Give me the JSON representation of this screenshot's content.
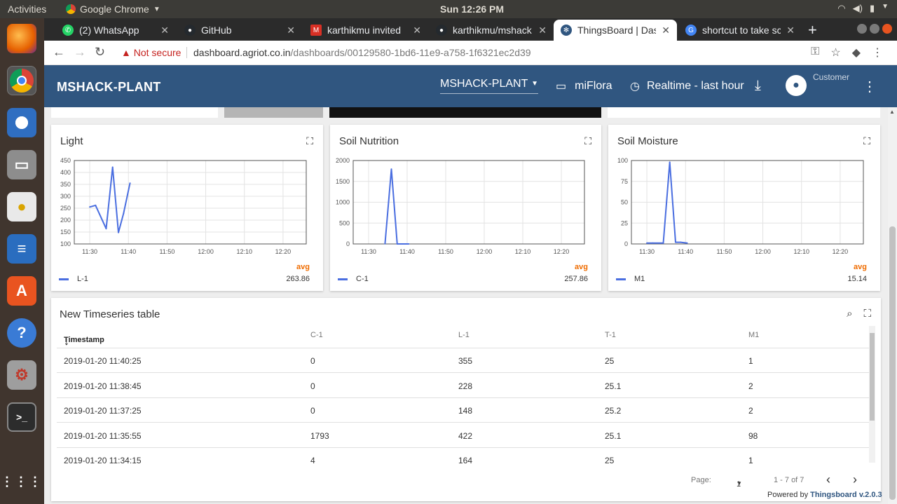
{
  "system": {
    "activities": "Activities",
    "app_name": "Google Chrome",
    "clock": "Sun 12:26 PM"
  },
  "tabs": [
    {
      "title": "(2) WhatsApp",
      "color": "#25d366"
    },
    {
      "title": "GitHub",
      "color": "#24292e"
    },
    {
      "title": "karthikmu invited",
      "color": "#d93025"
    },
    {
      "title": "karthikmu/mshack",
      "color": "#24292e"
    },
    {
      "title": "ThingsBoard | Das",
      "color": "#305680"
    },
    {
      "title": "shortcut to take sc",
      "color": "#4285f4"
    }
  ],
  "address_bar": {
    "security": "Not secure",
    "url_host": "dashboard.agriot.co.in",
    "url_path": "/dashboards/00129580-1bd6-11e9-a758-1f6321ec2d39"
  },
  "header": {
    "title": "MSHACK-PLANT",
    "dashboard_select": "MSHACK-PLANT",
    "entity": "miFlora",
    "timewindow": "Realtime - last hour",
    "user_role": "Customer"
  },
  "widgets": [
    {
      "title": "Light",
      "legend": "L-1",
      "avg_label": "avg",
      "avg": "263.86"
    },
    {
      "title": "Soil Nutrition",
      "legend": "C-1",
      "avg_label": "avg",
      "avg": "257.86"
    },
    {
      "title": "Soil Moisture",
      "legend": "M1",
      "avg_label": "avg",
      "avg": "15.14"
    }
  ],
  "chart_data": [
    {
      "type": "line",
      "title": "Light",
      "x_ticks": [
        "11:30",
        "11:40",
        "11:50",
        "12:00",
        "12:10",
        "12:20"
      ],
      "y_ticks": [
        100,
        150,
        200,
        250,
        300,
        350,
        400,
        450
      ],
      "ylim": [
        100,
        450
      ],
      "xlim": [
        "11:26",
        "12:26"
      ],
      "grid": true,
      "legend": "bottom-left",
      "series": [
        {
          "name": "L-1",
          "x": [
            "11:30:00",
            "11:31:30",
            "11:34:15",
            "11:35:55",
            "11:37:25",
            "11:38:45",
            "11:40:25"
          ],
          "values": [
            255,
            262,
            164,
            422,
            148,
            228,
            355
          ]
        }
      ]
    },
    {
      "type": "line",
      "title": "Soil Nutrition",
      "x_ticks": [
        "11:30",
        "11:40",
        "11:50",
        "12:00",
        "12:10",
        "12:20"
      ],
      "y_ticks": [
        0,
        500,
        1000,
        1500,
        2000
      ],
      "ylim": [
        0,
        2000
      ],
      "xlim": [
        "11:26",
        "12:26"
      ],
      "grid": true,
      "legend": "bottom-left",
      "series": [
        {
          "name": "C-1",
          "x": [
            "11:34:15",
            "11:35:55",
            "11:37:25",
            "11:38:45",
            "11:40:25"
          ],
          "values": [
            4,
            1793,
            0,
            0,
            0
          ]
        }
      ]
    },
    {
      "type": "line",
      "title": "Soil Moisture",
      "x_ticks": [
        "11:30",
        "11:40",
        "11:50",
        "12:00",
        "12:10",
        "12:20"
      ],
      "y_ticks": [
        0,
        25,
        50,
        75,
        100
      ],
      "ylim": [
        0,
        100
      ],
      "xlim": [
        "11:26",
        "12:26"
      ],
      "grid": true,
      "legend": "bottom-left",
      "series": [
        {
          "name": "M1",
          "x": [
            "11:30:00",
            "11:31:30",
            "11:34:15",
            "11:35:55",
            "11:37:25",
            "11:38:45",
            "11:40:25"
          ],
          "values": [
            1,
            1,
            1,
            98,
            2,
            2,
            1
          ]
        }
      ]
    }
  ],
  "table": {
    "title": "New Timeseries table",
    "columns": [
      "Timestamp",
      "C-1",
      "L-1",
      "T-1",
      "M1"
    ],
    "rows": [
      [
        "2019-01-20 11:40:25",
        "0",
        "355",
        "25",
        "1"
      ],
      [
        "2019-01-20 11:38:45",
        "0",
        "228",
        "25.1",
        "2"
      ],
      [
        "2019-01-20 11:37:25",
        "0",
        "148",
        "25.2",
        "2"
      ],
      [
        "2019-01-20 11:35:55",
        "1793",
        "422",
        "25.1",
        "98"
      ],
      [
        "2019-01-20 11:34:15",
        "4",
        "164",
        "25",
        "1"
      ]
    ],
    "page_label": "Page:",
    "page": "1",
    "range": "1 - 7 of 7"
  },
  "footer": {
    "powered_by": "Powered by",
    "brand": "Thingsboard v.2.0.3"
  }
}
